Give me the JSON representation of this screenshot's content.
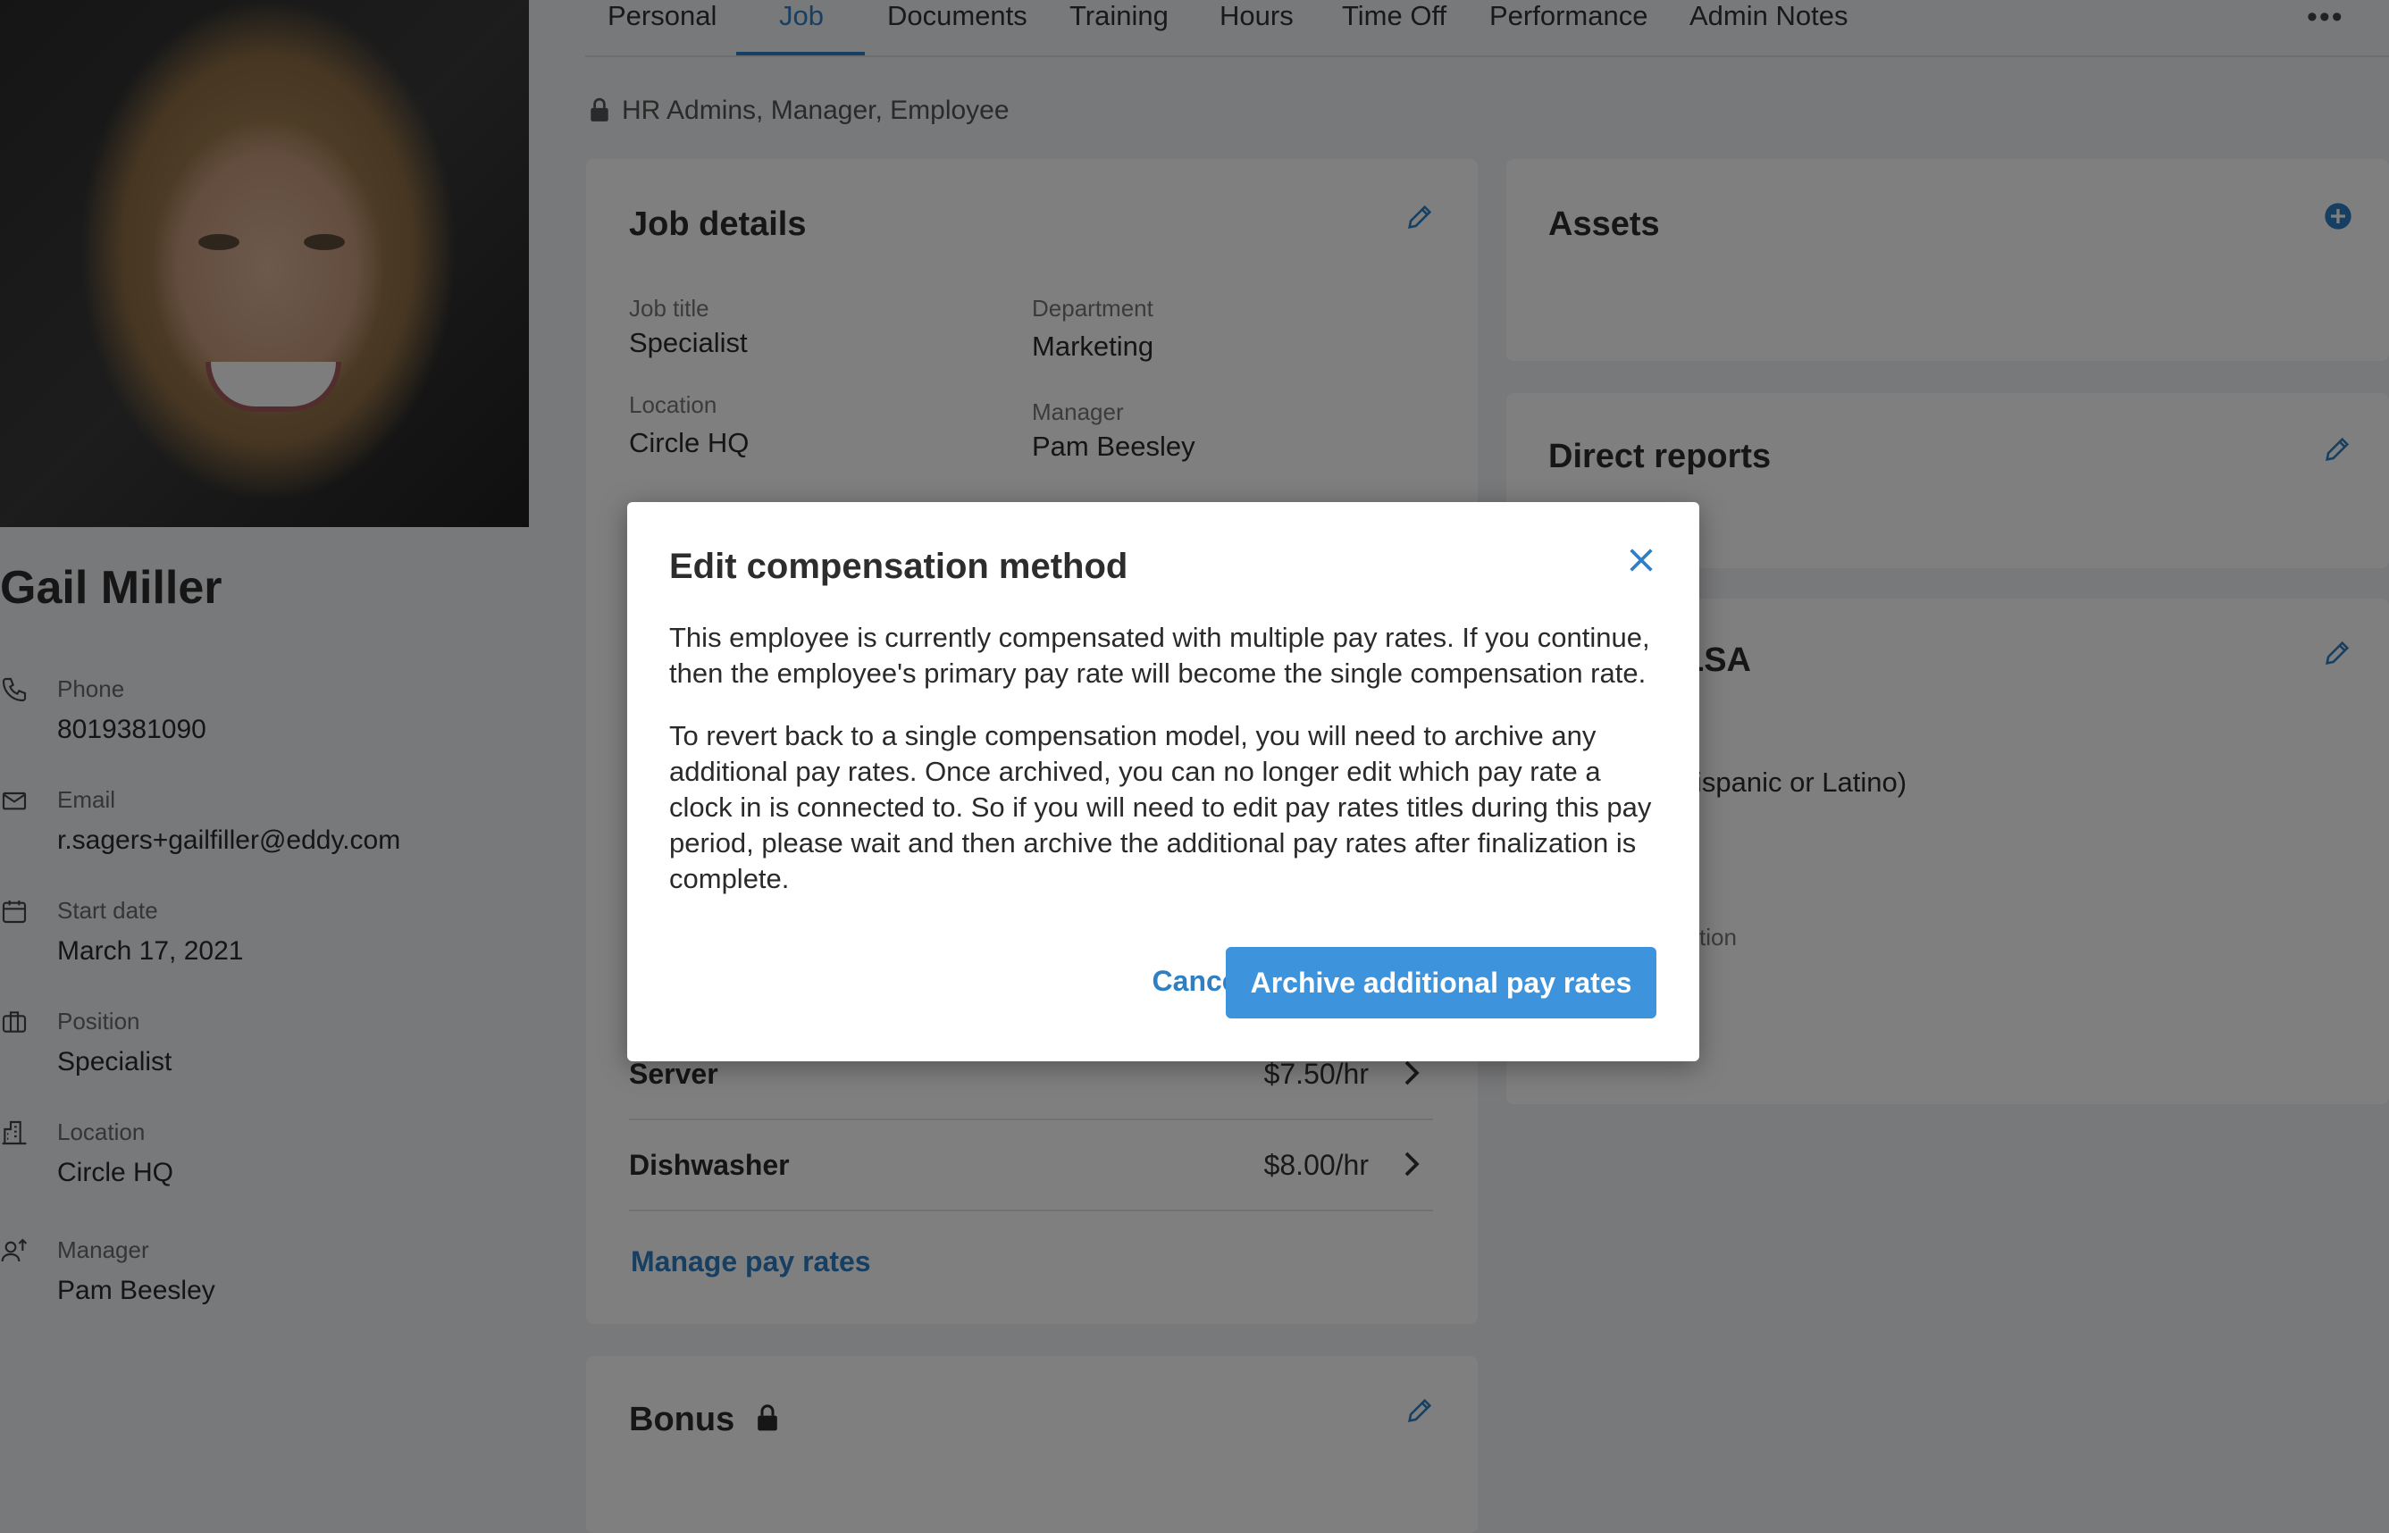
{
  "profile": {
    "name": "Gail Miller",
    "fields": [
      {
        "icon": "phone-icon",
        "label": "Phone",
        "value": "8019381090"
      },
      {
        "icon": "email-icon",
        "label": "Email",
        "value": "r.sagers+gailfiller@eddy.com"
      },
      {
        "icon": "calendar-icon",
        "label": "Start date",
        "value": "March 17, 2021"
      },
      {
        "icon": "briefcase-icon",
        "label": "Position",
        "value": "Specialist"
      },
      {
        "icon": "building-icon",
        "label": "Location",
        "value": "Circle HQ"
      },
      {
        "icon": "manager-icon",
        "label": "Manager",
        "value": "Pam Beesley"
      }
    ]
  },
  "tabs": [
    "Personal",
    "Job",
    "Documents",
    "Training",
    "Hours",
    "Time Off",
    "Performance",
    "Admin Notes"
  ],
  "active_tab": "Job",
  "more_menu": "•••",
  "access_text": "HR Admins, Manager, Employee",
  "job_details": {
    "title": "Job details",
    "job_title_label": "Job title",
    "job_title_value": "Specialist",
    "department_label": "Department",
    "department_value": "Marketing",
    "location_label": "Location",
    "location_value": "Circle HQ",
    "manager_label": "Manager",
    "manager_value": "Pam Beesley"
  },
  "pay_rates": [
    {
      "name": "Server",
      "rate": "$7.50/hr"
    },
    {
      "name": "Dishwasher",
      "rate": "$8.00/hr"
    }
  ],
  "manage_pay_rates": "Manage pay rates",
  "bonus_title": "Bonus",
  "assets_title": "Assets",
  "direct_reports_title": "Direct reports",
  "partial_flsa": "LSA",
  "partial_ethnicity": "ispanic or Latino)",
  "partial_label": "tion",
  "modal": {
    "title": "Edit compensation method",
    "paragraph1": "This employee is currently compensated with multiple pay rates. If you continue, then the employee's primary pay rate will become the single compensation rate.",
    "paragraph2": "To revert back to a single compensation model, you will need to archive any additional pay rates. Once archived, you can no longer edit which pay rate a clock in is connected to. So if you will need to edit pay rates titles during this pay period, please wait and then archive the additional pay rates after finalization is complete.",
    "cancel": "Cancel",
    "confirm": "Archive additional pay rates"
  },
  "colors": {
    "accent": "#2f7fc5",
    "primary_button": "#3d94dd"
  }
}
